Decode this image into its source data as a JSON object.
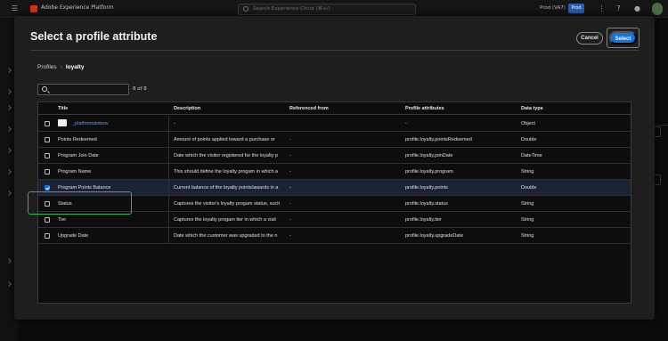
{
  "topbar": {
    "app_name": "Adobe Experience Platform",
    "search_placeholder": "Search Experience Cloud (⌘+/)",
    "sandbox_label": "Prod (VA7)",
    "prod_badge": "Prod"
  },
  "modal": {
    "title": "Select a profile attribute",
    "cancel_label": "Cancel",
    "select_label": "Select"
  },
  "breadcrumb": {
    "root": "Profiles",
    "separator": "›",
    "current": "loyalty"
  },
  "search": {
    "value": "",
    "result_count": "8 of 8"
  },
  "table": {
    "headers": {
      "title": "Title",
      "description": "Description",
      "referenced_from": "Referenced from",
      "profile_attributes": "Profile attributes",
      "data_type": "Data type"
    },
    "rows": [
      {
        "title": "_platformuintenv",
        "description": "-",
        "referenced_from": "",
        "profile_attribute": "-",
        "data_type": "Object",
        "checked": false,
        "is_folder": true
      },
      {
        "title": "Points Redeemed",
        "description": "Amount of points applied toward a purchase or",
        "referenced_from": "-",
        "profile_attribute": "profile.loyalty.pointsRedeemed",
        "data_type": "Double",
        "checked": false,
        "is_folder": false
      },
      {
        "title": "Program Join Date",
        "description": "Date which the visitor registered for the loyalty p",
        "referenced_from": "-",
        "profile_attribute": "profile.loyalty.joinDate",
        "data_type": "DateTime",
        "checked": false,
        "is_folder": false
      },
      {
        "title": "Program Name",
        "description": "This should define the loyalty progam in which a",
        "referenced_from": "-",
        "profile_attribute": "profile.loyalty.program",
        "data_type": "String",
        "checked": false,
        "is_folder": false
      },
      {
        "title": "Program Points Balance",
        "description": "Current balance of the loyalty points/awards in a",
        "referenced_from": "-",
        "profile_attribute": "profile.loyalty.points",
        "data_type": "Double",
        "checked": true,
        "is_folder": false
      },
      {
        "title": "Status",
        "description": "Captures the visitor's loyalty progam status, such",
        "referenced_from": "-",
        "profile_attribute": "profile.loyalty.status",
        "data_type": "String",
        "checked": false,
        "is_folder": false
      },
      {
        "title": "Tier",
        "description": "Captures the loyalty progam tier in which a visit",
        "referenced_from": "-",
        "profile_attribute": "profile.loyalty.tier",
        "data_type": "String",
        "checked": false,
        "is_folder": false
      },
      {
        "title": "Upgrade Date",
        "description": "Date which the customer was upgraded to the n",
        "referenced_from": "-",
        "profile_attribute": "profile.loyalty.upgradeDate",
        "data_type": "String",
        "checked": false,
        "is_folder": false
      }
    ]
  },
  "colors": {
    "accent": "#1473e6",
    "highlight": "#2cb94c",
    "link": "#4aa3ff"
  }
}
